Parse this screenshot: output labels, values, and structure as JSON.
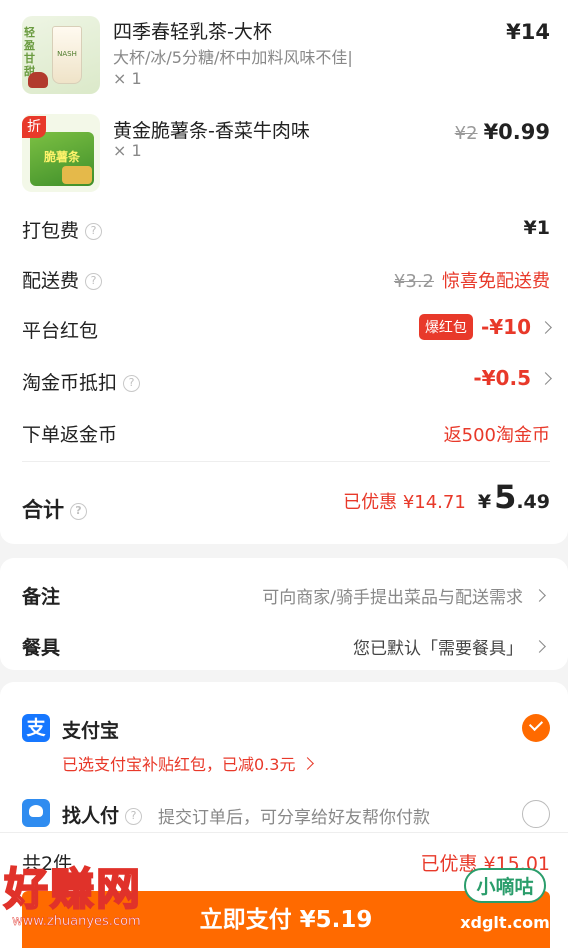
{
  "items": [
    {
      "name": "四季春轻乳茶-大杯",
      "spec": "大杯/冰/5分糖/杯中加料风味不佳|",
      "qty": "× 1",
      "price": "¥14",
      "thumb_text_1": "轻盈甘甜",
      "thumb_text_2": "NASH"
    },
    {
      "name": "黄金脆薯条-香菜牛肉味",
      "qty": "× 1",
      "old_price": "¥2",
      "price": "¥0.99",
      "discount_badge": "折",
      "thumb_text_1": "青菜",
      "thumb_text_2": "脆薯条",
      "thumb_text_3": "香菜味"
    }
  ],
  "fees": {
    "packing": {
      "label": "打包费",
      "value": "¥1"
    },
    "delivery": {
      "label": "配送费",
      "old": "¥3.2",
      "value": "惊喜免配送费"
    },
    "red_packet": {
      "label": "平台红包",
      "badge": "爆红包",
      "value": "-¥10"
    },
    "coin": {
      "label": "淘金币抵扣",
      "value": "-¥0.5"
    },
    "return_coin": {
      "label": "下单返金币",
      "value": "返500淘金币"
    }
  },
  "total": {
    "label": "合计",
    "saved": "已优惠 ¥14.71",
    "currency": "¥",
    "int": "5",
    "dec": ".49"
  },
  "remarks": {
    "note_label": "备注",
    "note_value": "可向商家/骑手提出菜品与配送需求",
    "utensils_label": "餐具",
    "utensils_value": "您已默认「需要餐具」"
  },
  "payment": {
    "alipay_label": "支付宝",
    "alipay_sub": "已选支付宝补贴红包，已减0.3元",
    "friend_label": "找人付",
    "friend_desc": "提交订单后，可分享给好友帮你付款"
  },
  "footer": {
    "count": "共2件",
    "saved": "已优惠 ¥15.01",
    "pay_button": "立即支付 ¥5.19"
  },
  "watermark": {
    "left_text": "好赚网",
    "left_url": "www.zhuanyes.com",
    "right_text": "小嘀咕",
    "right_url": "xdglt.com"
  },
  "colors": {
    "accent_red": "#e8392a",
    "pay_orange": "#ff6a00",
    "alipay_blue": "#1677ff"
  }
}
